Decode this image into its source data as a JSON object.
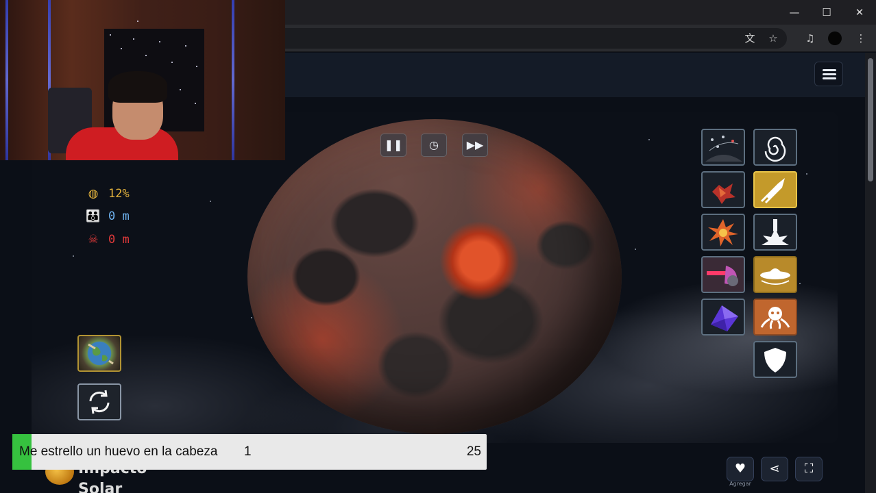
{
  "browser": {
    "window_controls": {
      "minimize": "—",
      "maximize": "☐",
      "close": "✕"
    },
    "toolbar_icons": [
      "translate-icon",
      "star-icon",
      "media-icon",
      "profile-icon",
      "more-icon"
    ]
  },
  "game": {
    "time_controls": {
      "pause": "❚❚",
      "clock": "◷",
      "fast_forward": "▶▶"
    },
    "stats": {
      "destruction": "12%",
      "population": "0 m",
      "deaths": "0 m"
    },
    "stat_colors": {
      "destruction": "#e3b23c",
      "population": "#6fb4f2",
      "deaths": "#e23a3a"
    },
    "tools_left_column": [
      "satellites-tool",
      "debris-tool",
      "explosion-tool",
      "laser-tool",
      "crystal-tool"
    ],
    "tools_right_column": [
      "black-hole-tool",
      "missile-tool",
      "nuke-tool",
      "ufo-tool",
      "alien-tool",
      "shield-tool"
    ],
    "selected_tool": "missile-tool",
    "brand": "Impacto Solar",
    "bottom_buttons": {
      "like_caption": "Agregar"
    }
  },
  "overlay": {
    "poll_text": "Me estrello un huevo en la cabeza",
    "poll_count": "1",
    "poll_total": "25",
    "poll_color": "#36c13f"
  }
}
